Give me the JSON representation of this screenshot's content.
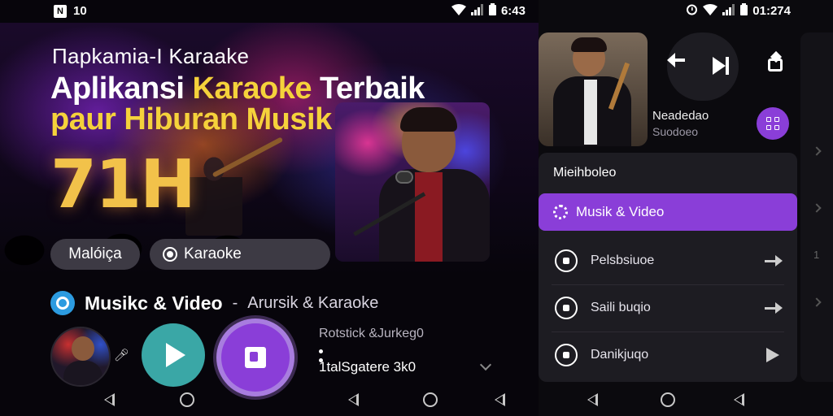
{
  "left": {
    "status": {
      "left_icon_1": "N",
      "left_icon_2": "10",
      "time": "6:43"
    },
    "hero": {
      "subtitle": "Пapkamia-I Karaake",
      "title_line1_a": "Aplikansi ",
      "title_line1_b": "Karaoke",
      "title_line1_c": " Terbaik",
      "title_line2_a": "paur",
      "title_line2_b": " Hiburan Musik",
      "big_number": "71H"
    },
    "chips": {
      "chip1": "Mаlóiça",
      "chip2": "Karaoke"
    },
    "section": {
      "title": "Musikc & Video",
      "dash": " - ",
      "subtitle": "Arursik & Karaoke"
    },
    "player": {
      "info_line1": "Rotstick &Jurkeg0",
      "info_line2": "1talSgatere 3k0"
    }
  },
  "right": {
    "status": {
      "time": "01:274"
    },
    "now_playing": {
      "title": "Neadedao",
      "subtitle": "Suodoeo"
    },
    "menu": {
      "header": "Mieihboleo",
      "active_item": "Musik & Video",
      "items": [
        {
          "label": "Pelsbsiuoe",
          "action": "arrow"
        },
        {
          "label": "Saili buqio",
          "action": "arrow"
        },
        {
          "label": "Danikjuqo",
          "action": "play"
        }
      ]
    },
    "side_number": "1"
  },
  "colors": {
    "accent": "#8a3ed8",
    "teal": "#3aa7a6",
    "gold": "#f5d23b"
  }
}
